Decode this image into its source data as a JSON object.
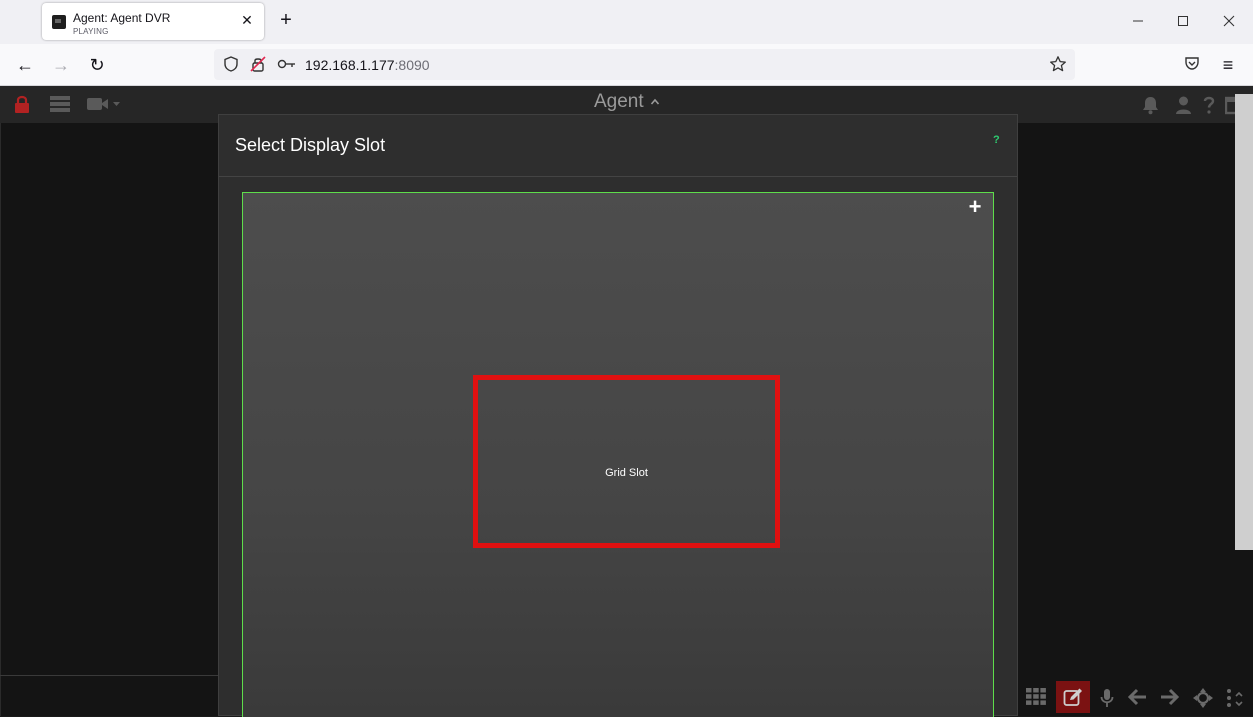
{
  "browser": {
    "tab": {
      "title": "Agent: Agent DVR",
      "subtitle": "PLAYING",
      "close_glyph": "✕"
    },
    "new_tab_glyph": "+",
    "window_controls": {
      "minimize_glyph": "—",
      "maximize_glyph": "☐",
      "close_glyph": "✕"
    },
    "nav": {
      "back_glyph": "←",
      "forward_glyph": "→",
      "reload_glyph": "↻"
    },
    "url": {
      "host": "192.168.1.177",
      "port": ":8090"
    },
    "menu_glyph": "≡"
  },
  "app": {
    "brand": "Agent",
    "icons": {
      "left": [
        "lock-icon",
        "server-icon",
        "camera-icon"
      ],
      "right": [
        "bell-icon",
        "user-icon",
        "help-icon",
        "window-icon"
      ],
      "bottom": [
        "grid-icon",
        "edit-icon",
        "microphone-icon",
        "arrow-left-icon",
        "arrow-right-icon",
        "move-icon",
        "more-icon"
      ]
    },
    "colors": {
      "accent_green": "#5edd4b",
      "highlight_red": "#e01010",
      "edit_active": "#7b1212"
    }
  },
  "modal": {
    "title": "Select Display Slot",
    "help": "?",
    "add_glyph": "+",
    "grid_slot_label": "Grid Slot"
  }
}
